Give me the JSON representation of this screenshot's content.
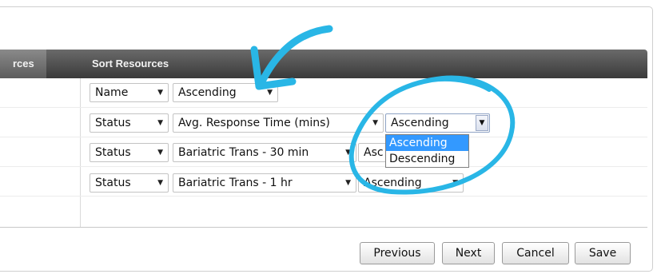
{
  "table": {
    "header_partial": "rces",
    "header_sort": "Sort Resources"
  },
  "rows": [
    {
      "field": "Name",
      "order": "Ascending"
    },
    {
      "field": "Status",
      "criteria": "Avg. Response Time (mins)",
      "order": "Ascending"
    },
    {
      "field": "Status",
      "criteria": "Bariatric Trans - 30 min",
      "order_partial": "Asc"
    },
    {
      "field": "Status",
      "criteria": "Bariatric Trans - 1 hr",
      "order": "Ascending"
    }
  ],
  "dropdown_options": [
    "Ascending",
    "Descending"
  ],
  "buttons": {
    "previous": "Previous",
    "next": "Next",
    "cancel": "Cancel",
    "save": "Save"
  },
  "annotation_color": "#29b6e6"
}
